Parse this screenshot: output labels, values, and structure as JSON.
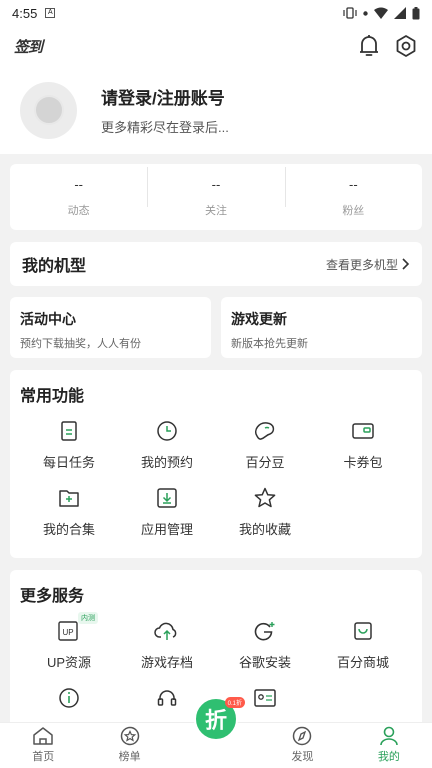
{
  "status_bar": {
    "time": "4:55",
    "left_icon": "A"
  },
  "top_bar": {
    "signin_label": "签到"
  },
  "profile": {
    "title": "请登录/注册账号",
    "subtitle": "更多精彩尽在登录后..."
  },
  "stats": [
    {
      "value": "--",
      "label": "动态"
    },
    {
      "value": "--",
      "label": "关注"
    },
    {
      "value": "--",
      "label": "粉丝"
    }
  ],
  "my_models": {
    "title": "我的机型",
    "more_label": "查看更多机型"
  },
  "promos": [
    {
      "title": "活动中心",
      "subtitle": "预约下载抽奖，人人有份"
    },
    {
      "title": "游戏更新",
      "subtitle": "新版本抢先更新"
    }
  ],
  "features": {
    "title": "常用功能",
    "items": [
      {
        "label": "每日任务",
        "icon": "task-icon"
      },
      {
        "label": "我的预约",
        "icon": "clock-icon"
      },
      {
        "label": "百分豆",
        "icon": "bean-icon"
      },
      {
        "label": "卡券包",
        "icon": "wallet-icon"
      },
      {
        "label": "我的合集",
        "icon": "collection-icon"
      },
      {
        "label": "应用管理",
        "icon": "download-icon"
      },
      {
        "label": "我的收藏",
        "icon": "star-icon"
      }
    ]
  },
  "services": {
    "title": "更多服务",
    "badge": "内测",
    "items": [
      {
        "label": "UP资源",
        "icon": "up-icon"
      },
      {
        "label": "游戏存档",
        "icon": "cloud-upload-icon"
      },
      {
        "label": "谷歌安装",
        "icon": "google-icon"
      },
      {
        "label": "百分商城",
        "icon": "shop-icon"
      }
    ]
  },
  "tab_bar": {
    "items": [
      {
        "label": "首页",
        "icon": "home-icon"
      },
      {
        "label": "榜单",
        "icon": "ranking-icon"
      },
      {
        "label": "折",
        "icon": "discount-icon"
      },
      {
        "label": "发现",
        "icon": "discover-icon"
      },
      {
        "label": "我的",
        "icon": "profile-icon"
      }
    ],
    "center_badge": "0.1折",
    "active_color": "#2aa05a"
  },
  "colors": {
    "accent": "#2aa05a",
    "discount": "#2fbf71",
    "background": "#f2f2f2"
  }
}
